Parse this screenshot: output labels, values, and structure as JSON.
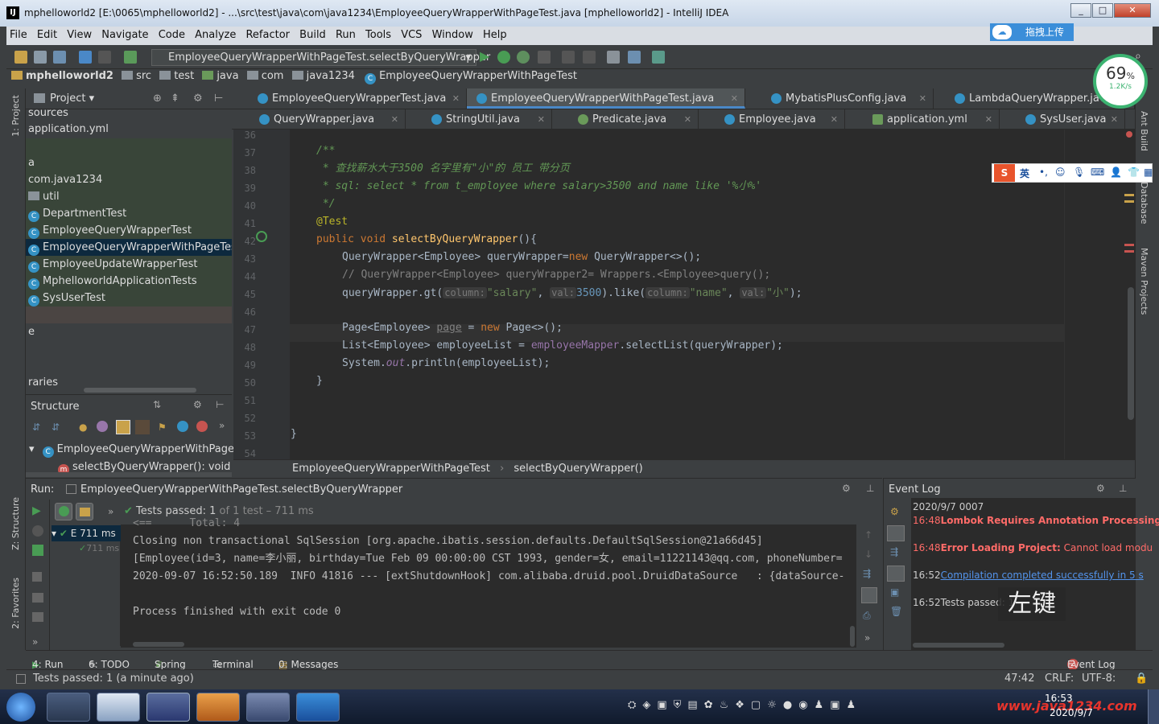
{
  "window": {
    "title": "mphelloworld2 [E:\\0065\\mphelloworld2] - ...\\src\\test\\java\\com\\java1234\\EmployeeQueryWrapperWithPageTest.java [mphelloworld2] - IntelliJ IDEA",
    "min": "_",
    "max": "□",
    "close": "✕"
  },
  "menu": [
    "File",
    "Edit",
    "View",
    "Navigate",
    "Code",
    "Analyze",
    "Refactor",
    "Build",
    "Run",
    "Tools",
    "VCS",
    "Window",
    "Help"
  ],
  "baidu_upload": "拖拽上传",
  "run_config": "EmployeeQueryWrapperWithPageTest.selectByQueryWrapper",
  "nav": [
    "mphelloworld2",
    "src",
    "test",
    "java",
    "com",
    "java1234",
    "EmployeeQueryWrapperWithPageTest"
  ],
  "project": {
    "header": "Project",
    "rows": [
      "sources",
      "application.yml",
      "",
      "a",
      "com.java1234",
      "util",
      "DepartmentTest",
      "EmployeeQueryWrapperTest",
      "EmployeeQueryWrapperWithPageTest",
      "EmployeeUpdateWrapperTest",
      "MphelloworldApplicationTests",
      "SysUserTest",
      "",
      "e",
      "",
      "raries"
    ]
  },
  "structure": {
    "header": "Structure",
    "class": "EmployeeQueryWrapperWithPage",
    "method": "selectByQueryWrapper(): void"
  },
  "tabs_row1": [
    "EmployeeQueryWrapperTest.java",
    "EmployeeQueryWrapperWithPageTest.java",
    "MybatisPlusConfig.java",
    "LambdaQueryWrapper.java"
  ],
  "tabs_row2": [
    "QueryWrapper.java",
    "StringUtil.java",
    "Predicate.java",
    "Employee.java",
    "application.yml",
    "SysUser.java"
  ],
  "line_numbers": [
    "36",
    "37",
    "38",
    "39",
    "40",
    "41",
    "42",
    "43",
    "44",
    "45",
    "46",
    "47",
    "48",
    "49",
    "50",
    "51",
    "52",
    "53",
    "54"
  ],
  "code": {
    "l37": "/**",
    "l38": " * 查找薪水大于3500 名字里有\"小\"的 员工 带分页",
    "l39": " * sql: select * from t_employee where salary>3500 and name like '%小%'",
    "l40": " */",
    "l41": "@Test",
    "l42_kw": "public void ",
    "l42_fn": "selectByQueryWrapper",
    "l42_rest": "(){",
    "l43_a": "QueryWrapper<Employee> queryWrapper=",
    "l43_kw": "new",
    "l43_b": " QueryWrapper<>();",
    "l44": "// QueryWrapper<Employee> queryWrapper2= Wrappers.<Employee>query();",
    "l45_a": "queryWrapper.gt(",
    "l45_h1": "column:",
    "l45_s1": "\"salary\"",
    "l45_c": ", ",
    "l45_h2": "val:",
    "l45_n": "3500",
    "l45_d": ").like(",
    "l45_h3": "column:",
    "l45_s2": "\"name\"",
    "l45_e": ", ",
    "l45_h4": "val:",
    "l45_s3": "\"小\"",
    "l45_f": ");",
    "l47_a": "Page<Employee> ",
    "l47_u": "page",
    "l47_b": " = ",
    "l47_kw": "new",
    "l47_c": " Page<>();",
    "l48_a": "List<Employee> employeeList = ",
    "l48_f": "employeeMapper",
    "l48_b": ".selectList(queryWrapper);",
    "l49_a": "System.",
    "l49_f": "out",
    "l49_b": ".println(employeeList);",
    "l50": "}",
    "l53": "}"
  },
  "breadcrumb": [
    "EmployeeQueryWrapperWithPageTest",
    "selectByQueryWrapper()"
  ],
  "run": {
    "label": "Run:",
    "config": "EmployeeQueryWrapperWithPageTest.selectByQueryWrapper",
    "passed": "Tests passed:",
    "count": "1",
    "of": "of 1 test – 711 ms",
    "tree_item": "E 711 ms",
    "tree_sub": "711 ms",
    "console": [
      "<==      Total: 4",
      "Closing non transactional SqlSession [org.apache.ibatis.session.defaults.DefaultSqlSession@21a66d45]",
      "[Employee(id=3, name=李小丽, birthday=Tue Feb 09 00:00:00 CST 1993, gender=女, email=11221143@qq.com, phoneNumber=",
      "2020-09-07 16:52:50.189  INFO 41816 --- [extShutdownHook] com.alibaba.druid.pool.DruidDataSource   : {dataSource-",
      "",
      "Process finished with exit code 0"
    ]
  },
  "eventlog": {
    "header": "Event Log",
    "date": "2020/9/7 0007",
    "e1_time": "16:48",
    "e1_text": "Lombok Requires Annotation Processing",
    "e2_time": "16:48",
    "e2_bold": "Error Loading Project:",
    "e2_text": " Cannot load modu",
    "e3_time": "16:52",
    "e3_link": "Compilation completed successfully in 5 s",
    "e4_time": "16:52",
    "e4_text": "Tests passed: 1"
  },
  "bottom_tabs": [
    "4: Run",
    "6: TODO",
    "Spring",
    "Terminal",
    "0: Messages",
    "Event Log"
  ],
  "event_badge": "2",
  "status": {
    "left": "Tests passed: 1 (a minute ago)",
    "pos": "47:42",
    "crlf": "CRLF:",
    "enc": "UTF-8:"
  },
  "side_left": [
    "1: Project",
    "Z: Structure",
    "2: Favorites"
  ],
  "side_right": [
    "Ant Build",
    "Database",
    "Maven Projects"
  ],
  "gauge": {
    "pct": "69",
    "unit": "%",
    "speed": "1.2K/s"
  },
  "ime": "英",
  "overlay": "左键",
  "taskbar": {
    "time": "16:53",
    "date": "2020/9/7",
    "watermark": "www.java1234.com"
  },
  "colors": {
    "accent": "#4a88c7",
    "keyword": "#cc7832",
    "comment": "#629755",
    "string": "#6a8759",
    "number": "#6897bb",
    "field": "#9876aa",
    "annotation": "#bbb529",
    "function": "#ffc66d",
    "error": "#ff6b68",
    "link": "#5394ec"
  }
}
